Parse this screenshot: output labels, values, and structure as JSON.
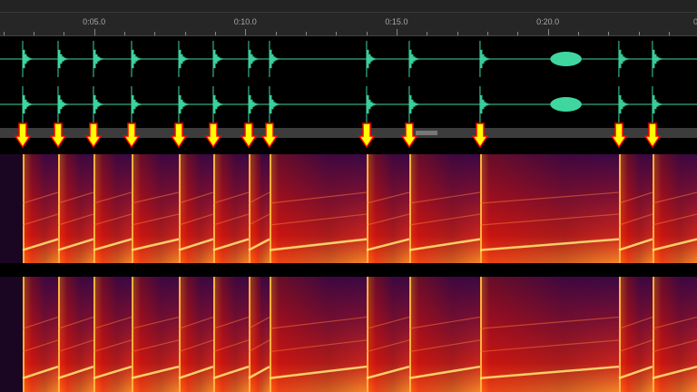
{
  "ruler": {
    "labels": [
      {
        "text": "0:05.0",
        "seconds": 5
      },
      {
        "text": "0:10.0",
        "seconds": 10
      },
      {
        "text": "0:15.0",
        "seconds": 15
      },
      {
        "text": "0:20.0",
        "seconds": 20
      },
      {
        "text": "0:2",
        "seconds": 25
      }
    ]
  },
  "events_seconds": [
    2.64,
    3.81,
    4.98,
    6.24,
    7.8,
    8.94,
    10.11,
    10.8,
    14.01,
    15.42,
    17.76,
    22.35,
    23.46
  ],
  "sustained_event_seconds": [
    20.2,
    21.0
  ],
  "colors": {
    "waveform": "#3fd6a0",
    "arrow_fill": "#ffff00",
    "arrow_stroke": "#ff0000",
    "spectrogram_low": "#1a0622",
    "spectrogram_high": "#ff9a2a"
  },
  "icons": {
    "marker": "down-arrow-icon"
  }
}
